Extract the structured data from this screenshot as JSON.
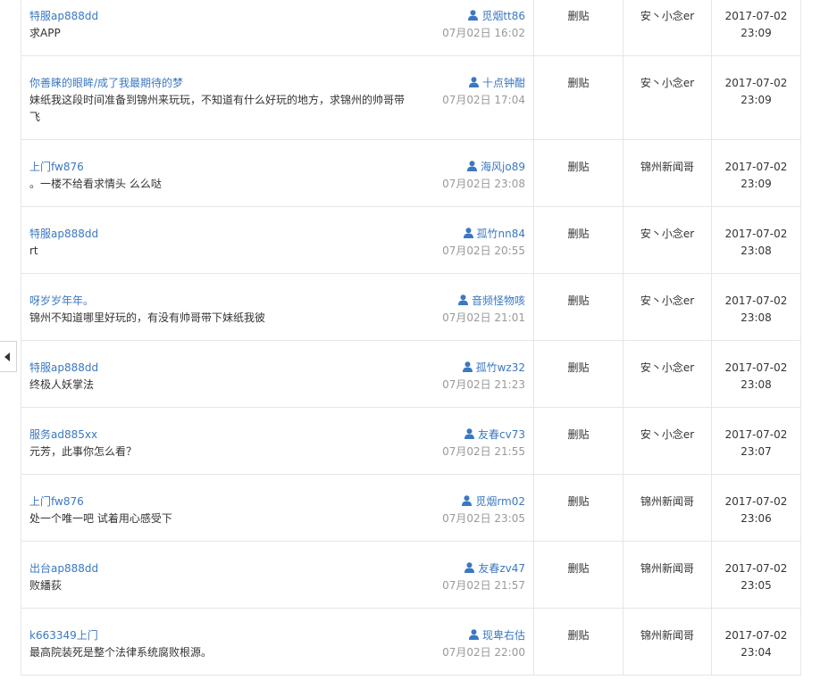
{
  "rows": [
    {
      "title": "特服ap888dd",
      "content": "求APP",
      "author": "觅烟tt86",
      "post_time": "07月02日 16:02",
      "action": "删贴",
      "operator": "安丶小念er",
      "op_date": "2017-07-02",
      "op_time": "23:09"
    },
    {
      "title": "你善睐的眼眸/成了我最期待的梦",
      "content": "妹纸我这段时间准备到锦州来玩玩，不知道有什么好玩的地方，求锦州的帅哥带飞",
      "author": "十点钟酣",
      "post_time": "07月02日 17:04",
      "action": "删贴",
      "operator": "安丶小念er",
      "op_date": "2017-07-02",
      "op_time": "23:09"
    },
    {
      "title": "上门fw876",
      "content": "。一楼不给看求情头 么么哒",
      "author": "海风jo89",
      "post_time": "07月02日 23:08",
      "action": "删贴",
      "operator": "锦州新闻哥",
      "op_date": "2017-07-02",
      "op_time": "23:09"
    },
    {
      "title": "特服ap888dd",
      "content": "rt",
      "author": "孤竹nn84",
      "post_time": "07月02日 20:55",
      "action": "删贴",
      "operator": "安丶小念er",
      "op_date": "2017-07-02",
      "op_time": "23:08"
    },
    {
      "title": "呀岁岁年年。",
      "content": "锦州不知道哪里好玩的，有没有帅哥带下妹纸我彼",
      "author": "音频怪物咳",
      "post_time": "07月02日 21:01",
      "action": "删贴",
      "operator": "安丶小念er",
      "op_date": "2017-07-02",
      "op_time": "23:08"
    },
    {
      "title": "特服ap888dd",
      "content": "终极人妖掌法",
      "author": "孤竹wz32",
      "post_time": "07月02日 21:23",
      "action": "删贴",
      "operator": "安丶小念er",
      "op_date": "2017-07-02",
      "op_time": "23:08"
    },
    {
      "title": "服务ad885xx",
      "content": "元芳，此事你怎么看？",
      "author": "友春cv73",
      "post_time": "07月02日 21:55",
      "action": "删贴",
      "operator": "安丶小念er",
      "op_date": "2017-07-02",
      "op_time": "23:07"
    },
    {
      "title": "上门fw876",
      "content": "处一个唯一吧 试着用心感受下",
      "author": "觅烟rm02",
      "post_time": "07月02日 23:05",
      "action": "删贴",
      "operator": "锦州新闻哥",
      "op_date": "2017-07-02",
      "op_time": "23:06"
    },
    {
      "title": "出台ap888dd",
      "content": "败繙荻",
      "author": "友春zv47",
      "post_time": "07月02日 21:57",
      "action": "删贴",
      "operator": "锦州新闻哥",
      "op_date": "2017-07-02",
      "op_time": "23:05"
    },
    {
      "title": "k663349上门",
      "content": "最高院装死是整个法律系统腐败根源。",
      "author": "现卑右估",
      "post_time": "07月02日 22:00",
      "action": "删贴",
      "operator": "锦州新闻哥",
      "op_date": "2017-07-02",
      "op_time": "23:04"
    }
  ],
  "icons": {
    "author_icon": "user-icon",
    "collapse_icon": "caret-left-icon"
  },
  "colors": {
    "link": "#3a78c1",
    "text": "#333333",
    "muted": "#999999",
    "border": "#e6e6e6"
  }
}
